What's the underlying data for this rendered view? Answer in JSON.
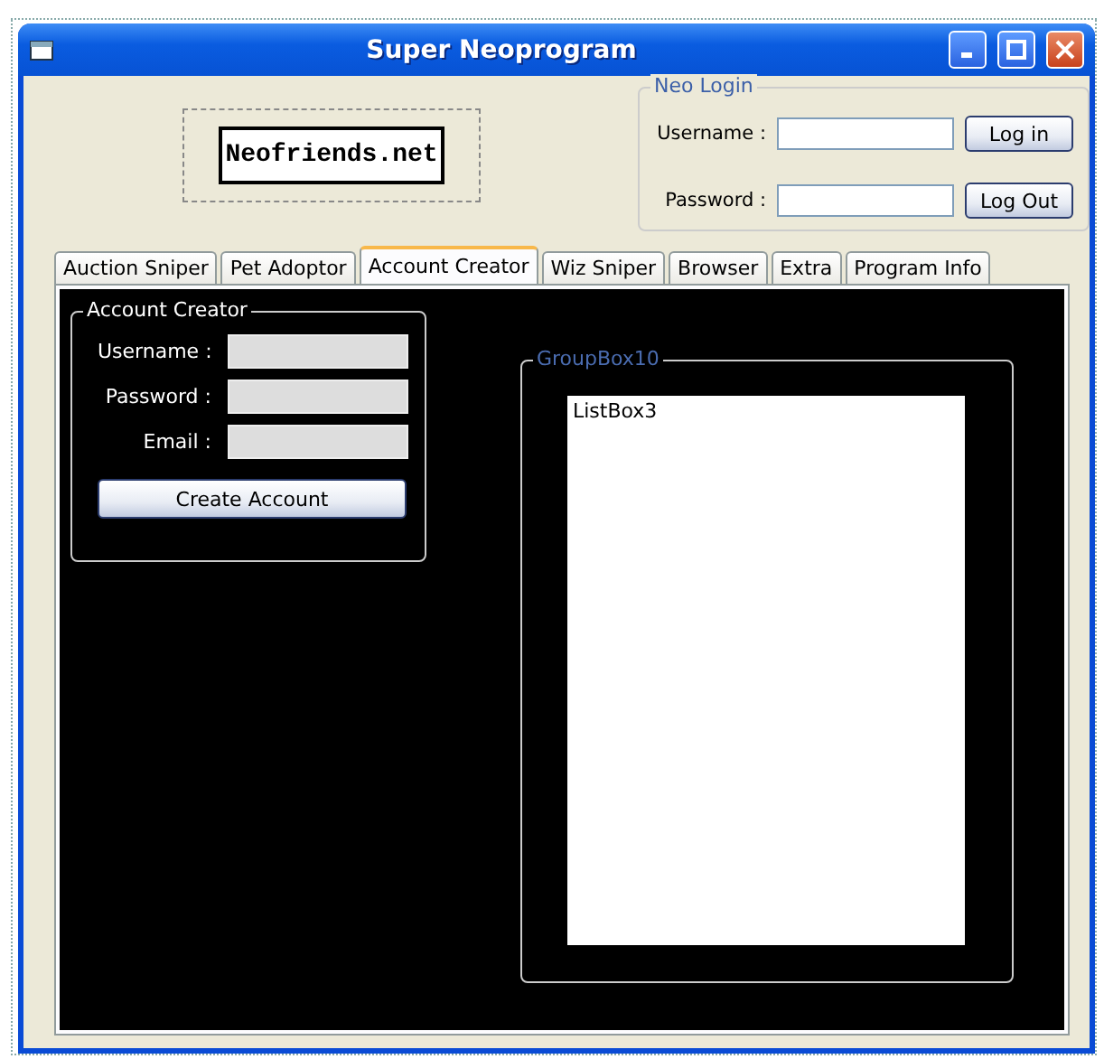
{
  "window": {
    "title": "Super Neoprogram"
  },
  "logo": {
    "text": "Neofriends.net"
  },
  "neo_login": {
    "title": "Neo Login",
    "fields": [
      {
        "label": "Username :"
      },
      {
        "label": "Password :"
      }
    ],
    "buttons": [
      "Log in",
      "Log Out"
    ]
  },
  "tabs": [
    {
      "label": "Auction Sniper",
      "selected": false
    },
    {
      "label": "Pet Adoptor",
      "selected": false
    },
    {
      "label": "Account Creator",
      "selected": true
    },
    {
      "label": "Wiz Sniper",
      "selected": false
    },
    {
      "label": "Browser",
      "selected": false
    },
    {
      "label": "Extra",
      "selected": false
    },
    {
      "label": "Program Info",
      "selected": false
    }
  ],
  "account_creator": {
    "title": "Account Creator",
    "fields": [
      {
        "label": "Username :"
      },
      {
        "label": "Password :"
      },
      {
        "label": "Email :"
      }
    ],
    "button": "Create Account"
  },
  "group_box": {
    "title": "GroupBox10",
    "list_box": {
      "items": [
        "ListBox3"
      ]
    }
  }
}
